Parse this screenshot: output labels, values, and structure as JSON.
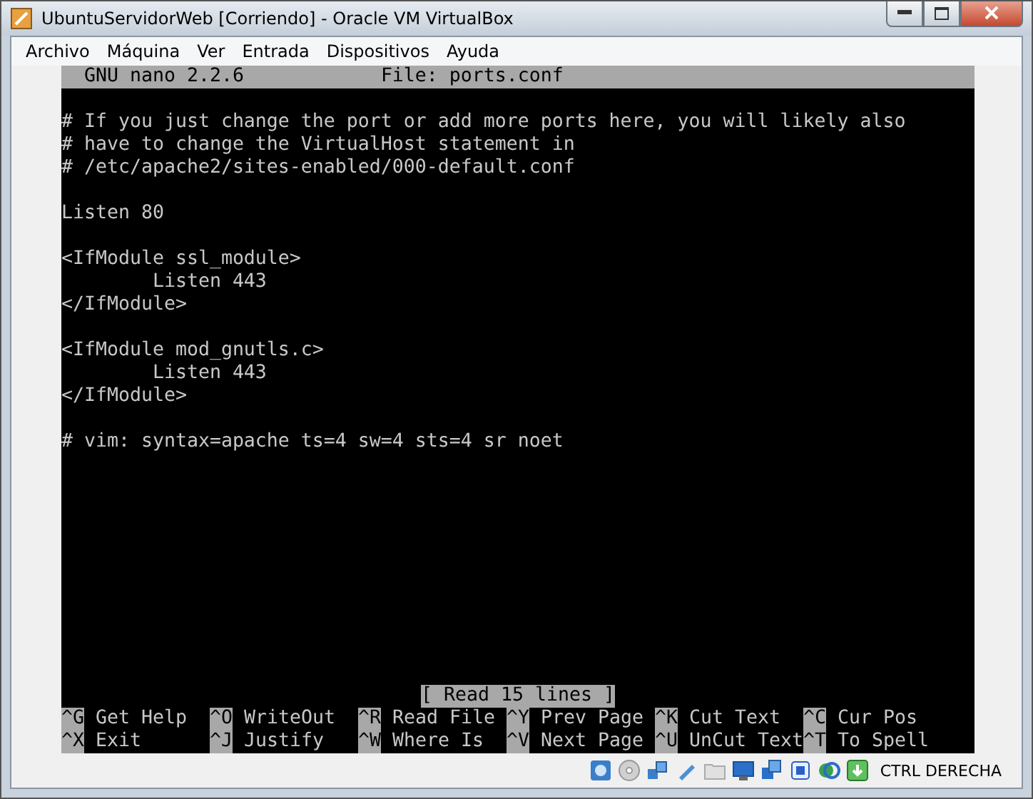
{
  "window": {
    "title": "UbuntuServidorWeb [Corriendo] - Oracle VM VirtualBox"
  },
  "menu": [
    "Archivo",
    "Máquina",
    "Ver",
    "Entrada",
    "Dispositivos",
    "Ayuda"
  ],
  "nano": {
    "version": "GNU nano 2.2.6",
    "file": "File: ports.conf",
    "blocks": [
      [
        "# If you just change the port or add more ports here, you will likely also",
        "# have to change the VirtualHost statement in",
        "# /etc/apache2/sites-enabled/000-default.conf"
      ],
      [
        "Listen 80"
      ],
      [
        "<IfModule ssl_module>",
        "        Listen 443",
        "</IfModule>"
      ],
      [
        "<IfModule mod_gnutls.c>",
        "        Listen 443",
        "</IfModule>"
      ],
      [
        "# vim: syntax=apache ts=4 sw=4 sts=4 sr noet"
      ]
    ],
    "message": "[ Read 15 lines ]",
    "shortcuts": [
      [
        {
          "key": "^G",
          "label": "Get Help"
        },
        {
          "key": "^O",
          "label": "WriteOut"
        },
        {
          "key": "^R",
          "label": "Read File"
        },
        {
          "key": "^Y",
          "label": "Prev Page"
        },
        {
          "key": "^K",
          "label": "Cut Text"
        },
        {
          "key": "^C",
          "label": "Cur Pos"
        }
      ],
      [
        {
          "key": "^X",
          "label": "Exit"
        },
        {
          "key": "^J",
          "label": "Justify"
        },
        {
          "key": "^W",
          "label": "Where Is"
        },
        {
          "key": "^V",
          "label": "Next Page"
        },
        {
          "key": "^U",
          "label": "UnCut Text"
        },
        {
          "key": "^T",
          "label": "To Spell"
        }
      ]
    ]
  },
  "status_bar": {
    "host_key": "CTRL DERECHA"
  }
}
